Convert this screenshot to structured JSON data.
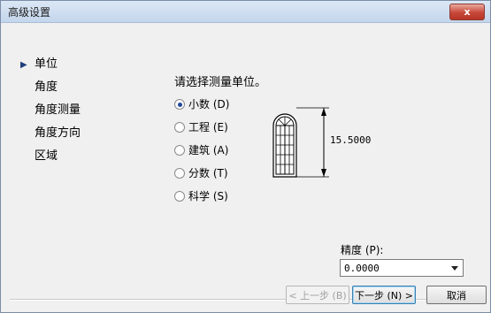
{
  "window": {
    "title": "高级设置",
    "close_label": "x"
  },
  "nav": {
    "items": [
      {
        "label": "单位",
        "active": true
      },
      {
        "label": "角度",
        "active": false
      },
      {
        "label": "角度测量",
        "active": false
      },
      {
        "label": "角度方向",
        "active": false
      },
      {
        "label": "区域",
        "active": false
      }
    ]
  },
  "instruction": "请选择测量单位。",
  "units": {
    "selected": "小数",
    "options": [
      {
        "label": "小数",
        "hotkey": "(D)"
      },
      {
        "label": "工程",
        "hotkey": "(E)"
      },
      {
        "label": "建筑",
        "hotkey": "(A)"
      },
      {
        "label": "分数",
        "hotkey": "(T)"
      },
      {
        "label": "科学",
        "hotkey": "(S)"
      }
    ]
  },
  "preview": {
    "dimension": "15.5000",
    "icon": "window-dimension-icon"
  },
  "precision": {
    "label": "精度 (P):",
    "value": "0.0000"
  },
  "buttons": {
    "back": "< 上一步 (B)",
    "next": "下一步 (N) >",
    "cancel": "取消"
  }
}
